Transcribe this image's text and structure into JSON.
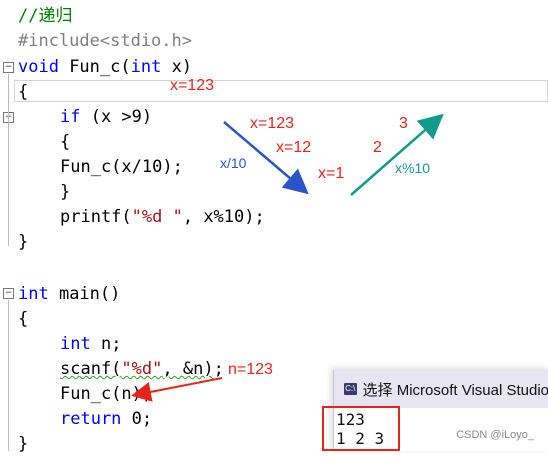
{
  "code": {
    "comment": "//递归",
    "include": "#include<stdio.h>",
    "func_sig": "void Fun_c(int x)",
    "brace_open": "{",
    "if_line": "if (x >9)",
    "brace_open2": "{",
    "recurse": "Fun_c(x/10);",
    "brace_close2": "}",
    "printf": "printf(\"%d \", x%10);",
    "brace_close": "}",
    "main_sig": "int main()",
    "main_open": "{",
    "decl": "int n;",
    "scanf": "scanf(\"%d\", &n);",
    "call": "Fun_c(n);",
    "ret": "return 0;",
    "main_close": "}"
  },
  "annotations": {
    "x123_top": "x=123",
    "x123": "x=123",
    "x12": "x=12",
    "x1": "x=1",
    "div10": "x/10",
    "step2": "2",
    "step3": "3",
    "mod10": "x%10",
    "n123": "n=123"
  },
  "console": {
    "title": "选择 Microsoft Visual Studio",
    "out_line1": "123",
    "out_line2": "1 2 3"
  },
  "watermark": "CSDN @iLoyo_",
  "colors": {
    "annotation_red": "#e8231a",
    "annotation_blue": "#2a55c8",
    "annotation_teal": "#129a8c",
    "keyword": "#0000ff",
    "comment": "#008000"
  }
}
